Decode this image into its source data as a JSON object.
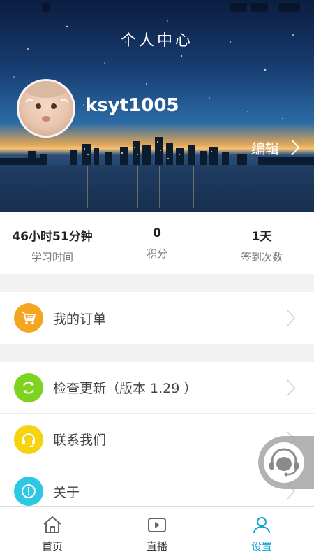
{
  "header": {
    "title": "个人中心",
    "username": "ksyt1005",
    "edit_label": "编辑"
  },
  "stats": [
    {
      "value": "46小时51分钟",
      "label": "学习时间"
    },
    {
      "value": "0",
      "label": "积分"
    },
    {
      "value": "1天",
      "label": "签到次数"
    }
  ],
  "menu": {
    "orders": {
      "label": "我的订单",
      "icon": "cart-icon",
      "color": "#f4a623"
    },
    "update": {
      "label": "检查更新（版本 1.29 ）",
      "icon": "refresh-icon",
      "color": "#7ed321"
    },
    "contact": {
      "label": "联系我们",
      "icon": "headset-icon",
      "color": "#f5d40f"
    },
    "about": {
      "label": "关于",
      "icon": "info-icon",
      "color": "#2cc7e3"
    }
  },
  "tabs": [
    {
      "label": "首页",
      "icon": "home-icon",
      "active": false
    },
    {
      "label": "直播",
      "icon": "tv-play-icon",
      "active": false
    },
    {
      "label": "设置",
      "icon": "user-icon",
      "active": true
    }
  ],
  "colors": {
    "accent": "#1aa3d8",
    "inactive": "#333333"
  }
}
